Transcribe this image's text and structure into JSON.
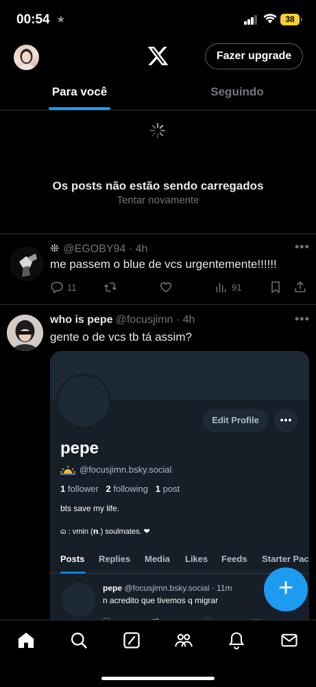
{
  "status_bar": {
    "time": "00:54",
    "battery": "38",
    "colors": {
      "battery": "#f5cd34"
    }
  },
  "header": {
    "logo": "x-logo-icon",
    "upgrade_label": "Fazer upgrade"
  },
  "tabs": [
    {
      "label": "Para você",
      "active": true
    },
    {
      "label": "Seguindo",
      "active": false
    }
  ],
  "error": {
    "title": "Os posts não estão sendo carregados",
    "retry_label": "Tentar novamente"
  },
  "tweets": [
    {
      "handle_line": "@EGOBY94 · 4h",
      "sparkle": "❊",
      "text": "me passem o blue de vcs urgentemente!!!!!!",
      "replies": "11",
      "views": "91"
    },
    {
      "name": "who is pepe",
      "handle_line": "@focusjimn · 4h",
      "text": "gente o de vcs tb tá assim?"
    }
  ],
  "embed": {
    "edit_profile_label": "Edit Profile",
    "name": "pepe",
    "handle": "@focusjimn.bsky.social",
    "followers_count": "1",
    "followers_label": "follower",
    "following_count": "2",
    "following_label": "following",
    "posts_count": "1",
    "posts_label": "post",
    "bio": "bts save my life.",
    "bio2": "ɷ : vmin (𝗻.) soulmates. ❤",
    "tabs": [
      "Posts",
      "Replies",
      "Media",
      "Likes",
      "Feeds",
      "Starter Pac"
    ],
    "post": {
      "name": "pepe",
      "handle_line": "@focusjimn.bsky.social · 11m",
      "text": "n acredito que tivemos q migrar"
    }
  },
  "fab": {
    "label": "+"
  },
  "colors": {
    "accent": "#1d9bf0",
    "background": "#000000",
    "secondary_text": "#71767b",
    "bsky_bg": "#161e27",
    "bsky_accent": "#0085ff"
  },
  "bottom_nav": [
    "home-icon",
    "search-icon",
    "grok-icon",
    "communities-icon",
    "notifications-icon",
    "messages-icon"
  ]
}
